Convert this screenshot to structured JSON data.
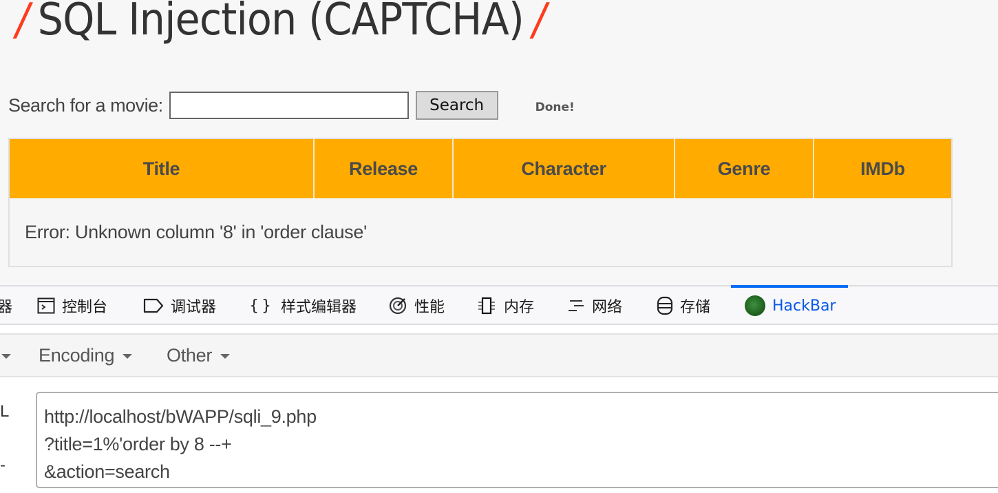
{
  "page": {
    "title": "SQL Injection (CAPTCHA)",
    "title_slash": "/",
    "search_label": "Search for a movie:",
    "search_value": "",
    "search_button": "Search",
    "status_text": "Done!",
    "table": {
      "headers": [
        "Title",
        "Release",
        "Character",
        "Genre",
        "IMDb"
      ],
      "rows": [
        [
          "Error: Unknown column '8' in 'order clause'"
        ]
      ]
    }
  },
  "devtools": {
    "tabs": [
      {
        "label": "器",
        "icon": "inspector-icon-partial"
      },
      {
        "label": "控制台",
        "icon": "console-icon"
      },
      {
        "label": "调试器",
        "icon": "debugger-icon"
      },
      {
        "label": "样式编辑器",
        "icon": "style-editor-icon"
      },
      {
        "label": "性能",
        "icon": "performance-icon"
      },
      {
        "label": "内存",
        "icon": "memory-icon"
      },
      {
        "label": "网络",
        "icon": "network-icon"
      },
      {
        "label": "存储",
        "icon": "storage-icon"
      },
      {
        "label": "HackBar",
        "icon": "hackbar-logo-icon",
        "active": true
      }
    ],
    "accent_color": "#0a6cf5"
  },
  "hackbar": {
    "menu": [
      {
        "label": "Encoding"
      },
      {
        "label": "Other"
      }
    ],
    "side_labels": [
      "L",
      "-"
    ],
    "url_value": "http://localhost/bWAPP/sqli_9.php\n?title=1%'order by 8 --+\n&action=search"
  }
}
